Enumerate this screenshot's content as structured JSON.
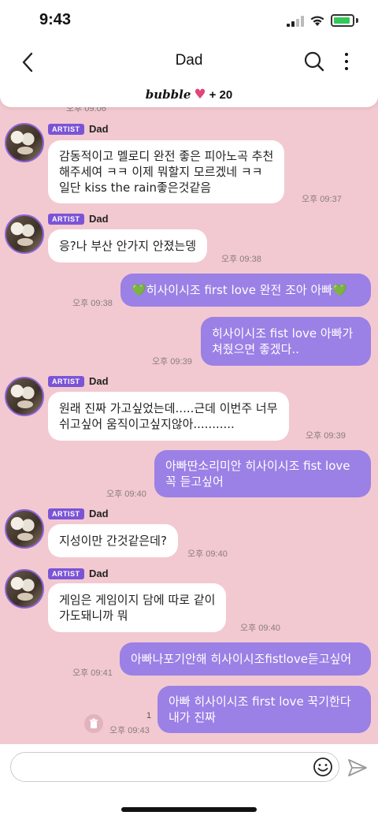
{
  "status": {
    "time": "9:43"
  },
  "header": {
    "title": "Dad"
  },
  "bubble_bar": {
    "word": "bubble",
    "count": "+ 20"
  },
  "artist_tag": "ARTIST",
  "messages": [
    {
      "side": "in",
      "sender": "Dad",
      "lines": [
        "감동적이고 멜로디 완전 좋은 피아노곡 추천",
        "해주세여 ㅋㅋ 이제 뭐할지 모르겠네 ㅋㅋ",
        "일단 kiss the rain좋은것같음"
      ],
      "time": "오후 09:37"
    },
    {
      "side": "in",
      "sender": "Dad",
      "lines": [
        "응?나 부산 안가지 안졌는뎅"
      ],
      "time": "오후 09:38"
    },
    {
      "side": "out",
      "lines": [
        "💚히사이시조 first love 완전 조아 아빠💚"
      ],
      "time": "오후 09:38"
    },
    {
      "side": "out",
      "lines": [
        "히사이시조 fist love 아빠가",
        "쳐줬으면 좋겠다.."
      ],
      "time": "오후 09:39"
    },
    {
      "side": "in",
      "sender": "Dad",
      "lines": [
        "원래 진짜 가고싶었는데.....근데 이번주 너무",
        "쉬고싶어 움직이고싶지않아..........."
      ],
      "time": "오후 09:39"
    },
    {
      "side": "out",
      "lines": [
        "아빠딴소리미안 히사이시조 fist love",
        "꼭 듣고싶어"
      ],
      "time": "오후 09:40"
    },
    {
      "side": "in",
      "sender": "Dad",
      "lines": [
        "지성이만 간것같은데?"
      ],
      "time": "오후 09:40"
    },
    {
      "side": "in",
      "sender": "Dad",
      "lines": [
        "게임은 게임이지 담에 따로 같이",
        "가도돼니까 뭐"
      ],
      "time": "오후 09:40"
    },
    {
      "side": "out",
      "lines": [
        "아빠나포기안해 히사이시조fistlove듣고싶어"
      ],
      "time": "오후 09:41"
    },
    {
      "side": "out",
      "lines": [
        "아빠 히사이시조 first love 꾹기한다",
        "내가 진짜"
      ],
      "time": "오후 09:43",
      "unread": "1"
    }
  ],
  "partial_time": "오후 09:06",
  "input": {
    "placeholder": ""
  },
  "icons": {
    "back": "chevron-left-icon",
    "search": "search-icon",
    "menu": "more-vertical-icon",
    "emoji": "smiley-icon",
    "send": "send-icon",
    "trash": "trash-icon",
    "heart": "heart-icon"
  },
  "colors": {
    "chat_bg": "#f2c9d0",
    "outgoing": "#9b80e6",
    "incoming": "#ffffff",
    "artist_tag": "#7b54d6",
    "heart": "#e0457b"
  }
}
